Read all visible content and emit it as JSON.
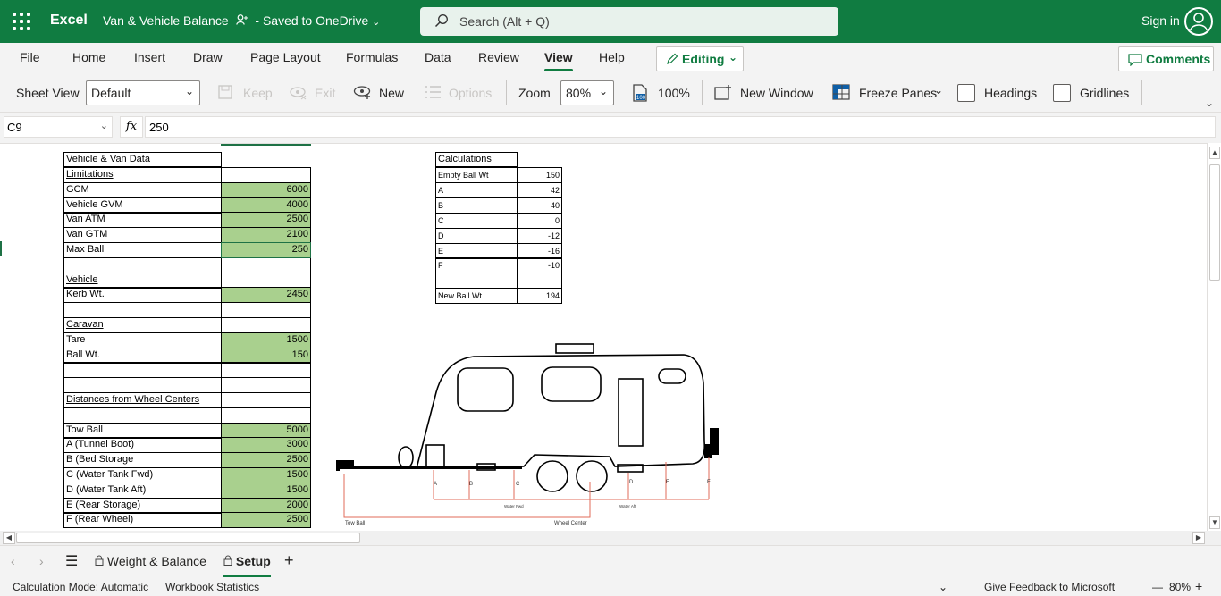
{
  "app": {
    "name": "Excel",
    "doc_title": "Van & Vehicle Balance",
    "save_status": "- Saved to OneDrive",
    "sign_in": "Sign in"
  },
  "search": {
    "placeholder": "Search (Alt + Q)"
  },
  "menu": {
    "tabs": [
      "File",
      "Home",
      "Insert",
      "Draw",
      "Page Layout",
      "Formulas",
      "Data",
      "Review",
      "View",
      "Help"
    ],
    "active_tab": "View",
    "editing": "Editing",
    "comments": "Comments"
  },
  "ribbon": {
    "sheet_view_label": "Sheet View",
    "sheet_view_value": "Default",
    "keep": "Keep",
    "exit": "Exit",
    "new": "New",
    "options": "Options",
    "zoom_label": "Zoom",
    "zoom_value": "80%",
    "zoom_100": "100%",
    "new_window": "New Window",
    "freeze_panes": "Freeze Panes",
    "headings": "Headings",
    "gridlines": "Gridlines"
  },
  "formula_bar": {
    "cell_ref": "C9",
    "fx": "fx",
    "value": "250"
  },
  "sheet": {
    "title_cell": "Vehicle & Van Data",
    "rows": [
      {
        "label": "Limitations",
        "value": "",
        "underline": true
      },
      {
        "label": "GCM",
        "value": "6000"
      },
      {
        "label": "Vehicle GVM",
        "value": "4000"
      },
      {
        "label": "Van ATM",
        "value": "2500"
      },
      {
        "label": "Van GTM",
        "value": "2100"
      },
      {
        "label": "Max Ball",
        "value": "250"
      },
      {
        "label": "",
        "value": ""
      },
      {
        "label": "Vehicle",
        "value": "",
        "underline": true
      },
      {
        "label": "Kerb Wt.",
        "value": "2450"
      },
      {
        "label": "",
        "value": ""
      },
      {
        "label": "Caravan",
        "value": "",
        "underline": true
      },
      {
        "label": "Tare",
        "value": "1500"
      },
      {
        "label": "Ball Wt.",
        "value": "150"
      },
      {
        "label": "",
        "value": ""
      },
      {
        "label": "",
        "value": ""
      },
      {
        "label": "Distances from Wheel Centers",
        "value": "",
        "underline": true
      },
      {
        "label": "",
        "value": ""
      },
      {
        "label": "Tow Ball",
        "value": "5000"
      },
      {
        "label": "A (Tunnel Boot)",
        "value": "3000"
      },
      {
        "label": "B (Bed Storage",
        "value": "2500"
      },
      {
        "label": "C (Water Tank Fwd)",
        "value": "1500"
      },
      {
        "label": "D (Water Tank Aft)",
        "value": "1500"
      },
      {
        "label": "E (Rear Storage)",
        "value": "2000"
      },
      {
        "label": "F (Rear Wheel)",
        "value": "2500"
      }
    ],
    "calc_title": "Calculations",
    "calc_rows": [
      {
        "label": "Empty Ball Wt",
        "value": "150"
      },
      {
        "label": "A",
        "value": "42"
      },
      {
        "label": "B",
        "value": "40"
      },
      {
        "label": "C",
        "value": "0"
      },
      {
        "label": "D",
        "value": "-12"
      },
      {
        "label": "E",
        "value": "-16"
      },
      {
        "label": "F",
        "value": "-10"
      },
      {
        "label": "",
        "value": ""
      },
      {
        "label": "New Ball Wt.",
        "value": "194"
      }
    ],
    "diagram": {
      "point_labels": [
        "A",
        "B",
        "C",
        "D",
        "E",
        "F"
      ],
      "water_fwd": "Water Fwd",
      "water_aft": "Water Aft",
      "tow_ball": "Tow Ball",
      "wheel_center": "Wheel Center"
    }
  },
  "sheet_tabs": {
    "items": [
      "Weight & Balance",
      "Setup"
    ],
    "active": "Setup"
  },
  "status_bar": {
    "calc_mode": "Calculation Mode: Automatic",
    "workbook_stats": "Workbook Statistics",
    "feedback": "Give Feedback to Microsoft",
    "zoom": "80%"
  },
  "colors": {
    "brand": "#107c41",
    "value_fill": "#a9d08e",
    "diagram_line": "#e06b5a"
  }
}
